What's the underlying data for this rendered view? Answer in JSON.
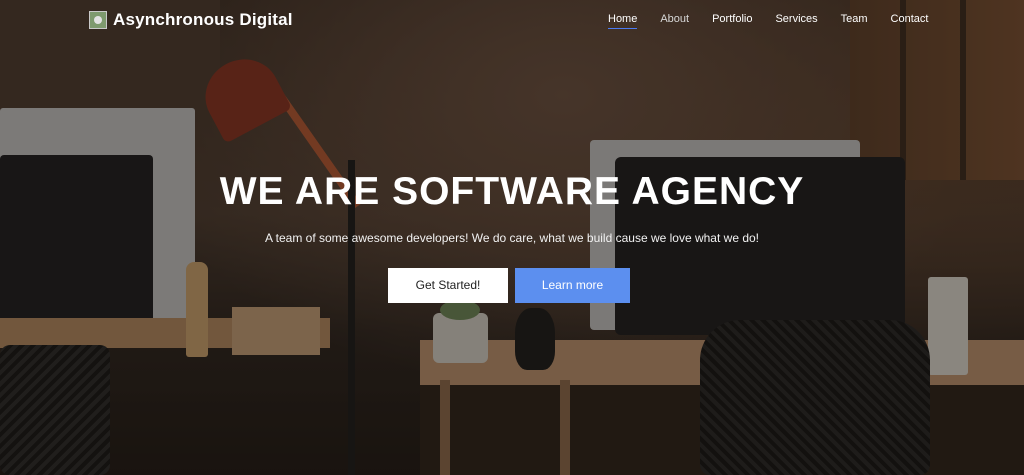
{
  "brand": {
    "name": "Asynchronous Digital",
    "logo_icon": "logo-icon"
  },
  "nav": {
    "items": [
      {
        "label": "Home",
        "active": true
      },
      {
        "label": "About",
        "active": false
      },
      {
        "label": "Portfolio",
        "active": false
      },
      {
        "label": "Services",
        "active": false
      },
      {
        "label": "Team",
        "active": false
      },
      {
        "label": "Contact",
        "active": false
      }
    ]
  },
  "hero": {
    "title": "WE ARE SOFTWARE AGENCY",
    "subtitle": "A team of some awesome developers! We do care, what we build cause we love what we do!",
    "primary_button": "Get Started!",
    "secondary_button": "Learn more"
  },
  "colors": {
    "accent": "#5c8fef",
    "active_underline": "#4c7bf2",
    "text": "#ffffff"
  }
}
